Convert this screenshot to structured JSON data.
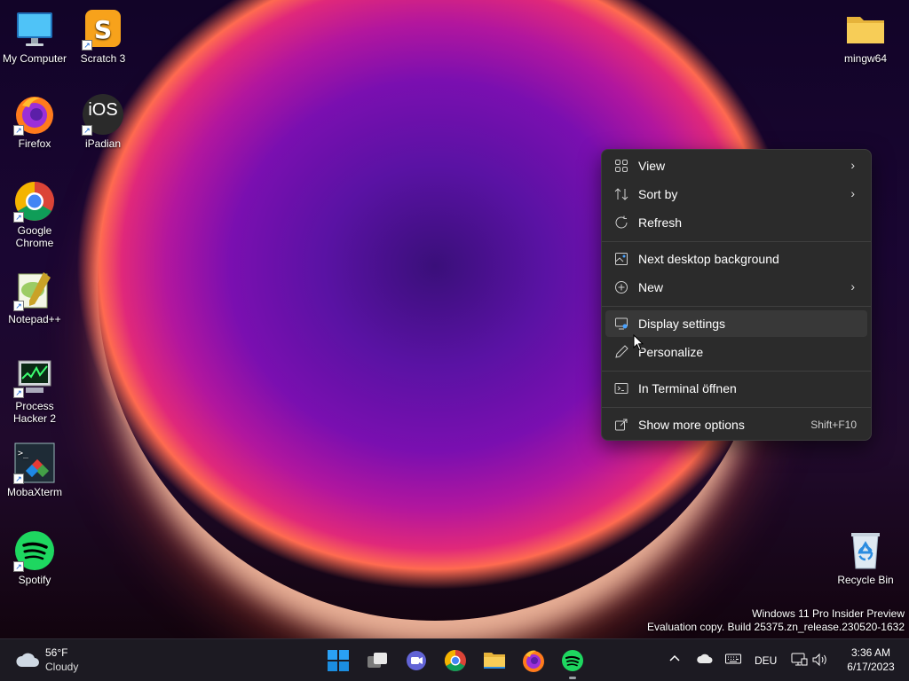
{
  "desktop_icons": {
    "my_computer": "My Computer",
    "scratch": "Scratch 3",
    "firefox": "Firefox",
    "ipadian": "iPadian",
    "ipadian_logo": "iOS",
    "chrome_line1": "Google",
    "chrome_line2": "Chrome",
    "notepadpp": "Notepad++",
    "process_line1": "Process",
    "process_line2": "Hacker 2",
    "mobaxterm": "MobaXterm",
    "spotify": "Spotify",
    "mingw64": "mingw64",
    "recycle_bin": "Recycle Bin"
  },
  "context_menu": {
    "items": [
      {
        "label": "View",
        "icon": "grid-icon",
        "submenu": true
      },
      {
        "label": "Sort by",
        "icon": "sort-icon",
        "submenu": true
      },
      {
        "label": "Refresh",
        "icon": "refresh-icon"
      },
      {
        "label": "Next desktop background",
        "icon": "image-icon"
      },
      {
        "label": "New",
        "icon": "plus-circle-icon",
        "submenu": true
      },
      {
        "label": "Display settings",
        "icon": "display-icon",
        "highlighted": true
      },
      {
        "label": "Personalize",
        "icon": "pen-icon"
      },
      {
        "label": "In Terminal öffnen",
        "icon": "terminal-icon"
      },
      {
        "label": "Show more options",
        "icon": "share-icon",
        "shortcut": "Shift+F10"
      }
    ]
  },
  "watermark": {
    "line1": "Windows 11 Pro Insider Preview",
    "line2": "Evaluation copy. Build 25375.zn_release.230520-1632"
  },
  "taskbar": {
    "weather_temp": "56°F",
    "weather_desc": "Cloudy",
    "language": "DEU",
    "time": "3:36 AM",
    "date": "6/17/2023"
  },
  "colors": {
    "menu_bg": "#2b2b2b",
    "taskbar_bg": "#1c1a22",
    "accent": "#0078d4"
  }
}
